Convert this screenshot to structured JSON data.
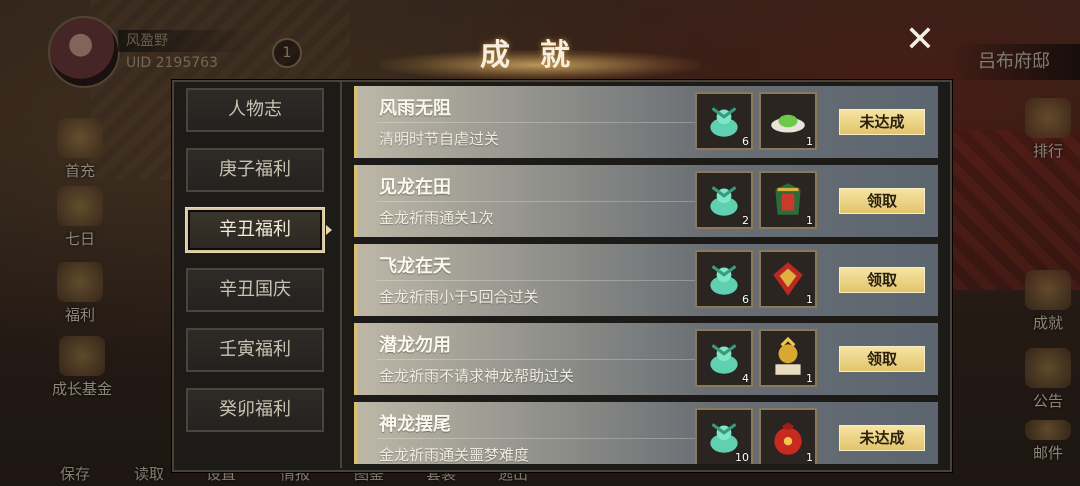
{
  "player": {
    "name": "风盈野",
    "uid": "UID  2195763",
    "badge": "1"
  },
  "location": "吕布府邸",
  "left_menu": [
    {
      "label": "首充"
    },
    {
      "label": "七日"
    },
    {
      "label": "福利"
    },
    {
      "label": "成长基金"
    }
  ],
  "right_menu": [
    {
      "label": "排行"
    },
    {
      "label": "成就"
    },
    {
      "label": "公告"
    },
    {
      "label": "邮件"
    }
  ],
  "bottom_menu": [
    "保存",
    "读取",
    "设置",
    "情报",
    "图鉴",
    "套装",
    "逃出"
  ],
  "dialog": {
    "title": "成就",
    "close_icon": "close-icon",
    "tabs": [
      "人物志",
      "庚子福利",
      "辛丑福利",
      "辛丑国庆",
      "壬寅福利",
      "癸卯福利"
    ],
    "active_tab": 2,
    "achievements": [
      {
        "name": "风雨无阻",
        "desc": "清明时节自虐过关",
        "reward1_count": "6",
        "reward2_count": "1",
        "reward2_icon": "green-food-icon",
        "status": "未达成"
      },
      {
        "name": "见龙在田",
        "desc": "金龙祈雨通关1次",
        "reward1_count": "2",
        "reward2_count": "1",
        "reward2_icon": "armor-icon",
        "status": "领取"
      },
      {
        "name": "飞龙在天",
        "desc": "金龙祈雨小于5回合过关",
        "reward1_count": "6",
        "reward2_count": "1",
        "reward2_icon": "crest-icon",
        "status": "领取"
      },
      {
        "name": "潜龙勿用",
        "desc": "金龙祈雨不请求神龙帮助过关",
        "reward1_count": "4",
        "reward2_count": "1",
        "reward2_icon": "golden-seal-icon",
        "status": "领取"
      },
      {
        "name": "神龙摆尾",
        "desc": "金龙祈雨通关噩梦难度",
        "reward1_count": "10",
        "reward2_count": "1",
        "reward2_icon": "red-bag-icon",
        "status": "未达成"
      }
    ]
  },
  "colors": {
    "button_gold": "#e8cc78",
    "row_accent": "#d8c070",
    "jade": "#5fd0b0"
  }
}
